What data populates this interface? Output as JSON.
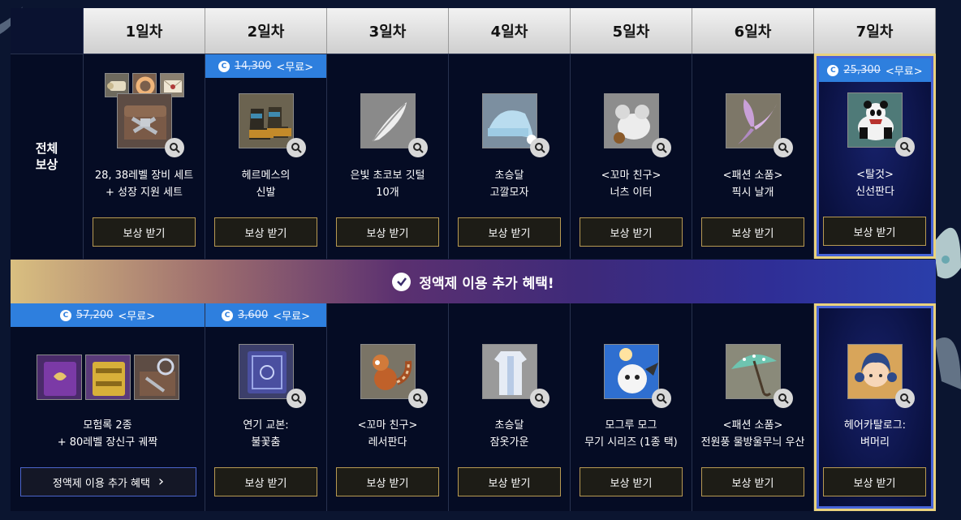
{
  "days": [
    "1일차",
    "2일차",
    "3일차",
    "4일차",
    "5일차",
    "6일차",
    "7일차"
  ],
  "row_label_lines": [
    "전체",
    "보상"
  ],
  "bonus_banner": "정액제 이용 추가 혜택!",
  "row1": [
    {
      "name": [
        "28, 38레벨 장비 세트",
        "+ 성장 지원 세트"
      ],
      "button": "보상 받기"
    },
    {
      "price": "14,300",
      "free": "<무료>",
      "name": [
        "헤르메스의",
        "신발"
      ],
      "button": "보상 받기"
    },
    {
      "name": [
        "은빛 초코보 깃털",
        "10개"
      ],
      "button": "보상 받기"
    },
    {
      "name": [
        "초승달",
        "고깔모자"
      ],
      "button": "보상 받기"
    },
    {
      "name": [
        "<꼬마 친구>",
        "너츠 이터"
      ],
      "button": "보상 받기"
    },
    {
      "name": [
        "<패션 소품>",
        "픽시 날개"
      ],
      "button": "보상 받기"
    },
    {
      "price": "25,300",
      "free": "<무료>",
      "name": [
        "<탈것>",
        "신선판다"
      ],
      "button": "보상 받기"
    }
  ],
  "row2": [
    {
      "price": "57,200",
      "free": "<무료>",
      "name": [
        "모험록 2종",
        "+ 80레벨 장신구 궤짝"
      ],
      "button": "정액제 이용 추가 혜택"
    },
    {
      "price": "3,600",
      "free": "<무료>",
      "name": [
        "연기 교본:",
        "불꽃춤"
      ],
      "button": "보상 받기"
    },
    {
      "name": [
        "<꼬마 친구>",
        "레서판다"
      ],
      "button": "보상 받기"
    },
    {
      "name": [
        "초승달",
        "잠옷가운"
      ],
      "button": "보상 받기"
    },
    {
      "name": [
        "모그루 모그",
        "무기 시리즈 (1종 택)"
      ],
      "button": "보상 받기"
    },
    {
      "name": [
        "<패션 소품>",
        "전원풍 물방울무늬 우산"
      ],
      "button": "보상 받기"
    },
    {
      "name": [
        "헤어카탈로그:",
        "벼머리"
      ],
      "button": "보상 받기"
    }
  ],
  "coin_glyph": "C",
  "chevron_glyph": "›",
  "colors": {
    "accent_blue": "#2e7fde",
    "gold_border": "#ead27d",
    "button_border": "#b89a52",
    "panel_bg": "#050c24"
  }
}
